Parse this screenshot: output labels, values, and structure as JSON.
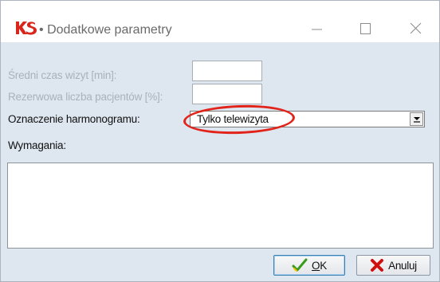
{
  "window": {
    "title": "Dodatkowe parametry",
    "title_separator": "•",
    "app_icon": "ks-logo-icon"
  },
  "titlebar_buttons": {
    "minimize": "minimize-icon",
    "maximize": "maximize-icon",
    "close": "close-icon"
  },
  "form": {
    "avg_visit_label": "Średni czas wizyt [min]:",
    "avg_visit_value": "",
    "reserve_label": "Rezerwowa liczba pacjentów [%]:",
    "reserve_value": "",
    "schedule_label": "Oznaczenie harmonogramu:",
    "schedule_selected": "Tylko telewizyta",
    "requirements_label": "Wymagania:",
    "requirements_value": ""
  },
  "buttons": {
    "ok_access_key": "O",
    "ok_rest": "K",
    "cancel_label": "Anuluj"
  },
  "colors": {
    "dialog_bg": "#dee6f0",
    "disabled_text": "#a9b1bd",
    "highlight": "#e2231a",
    "ok_icon": "#3a9a1a",
    "cancel_icon": "#d01010"
  }
}
